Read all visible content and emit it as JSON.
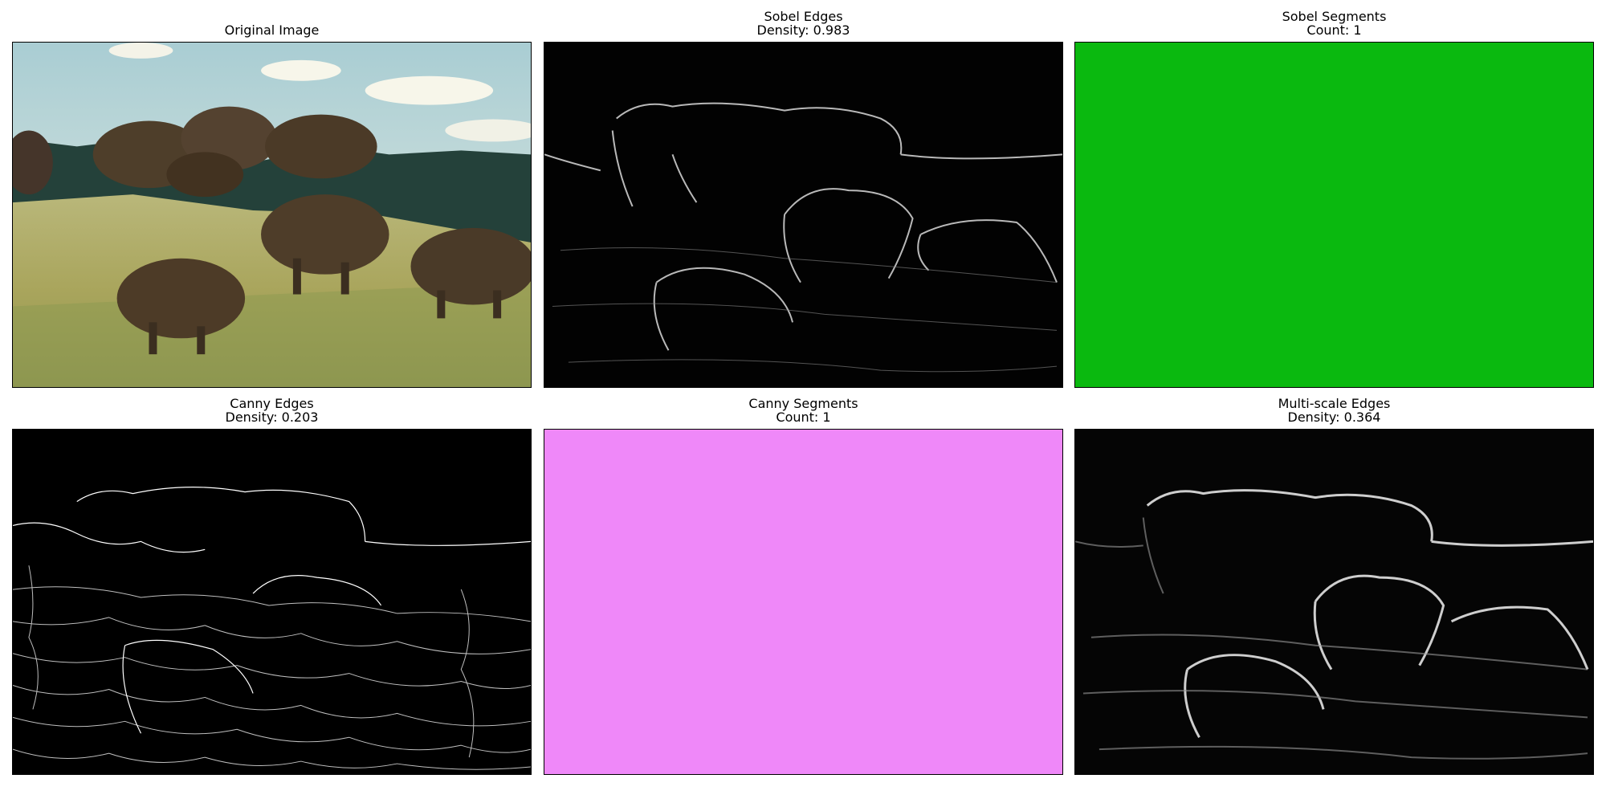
{
  "panels": {
    "original": {
      "title": "Original Image"
    },
    "sobel_edges": {
      "title": "Sobel Edges",
      "subtitle": "Density: 0.983"
    },
    "sobel_segments": {
      "title": "Sobel Segments",
      "subtitle": "Count: 1",
      "fill_color": "#0ab90f"
    },
    "canny_edges": {
      "title": "Canny Edges",
      "subtitle": "Density: 0.203"
    },
    "canny_segments": {
      "title": "Canny Segments",
      "subtitle": "Count: 1",
      "fill_color": "#ef88f9"
    },
    "multiscale_edges": {
      "title": "Multi-scale Edges",
      "subtitle": "Density: 0.364"
    }
  }
}
